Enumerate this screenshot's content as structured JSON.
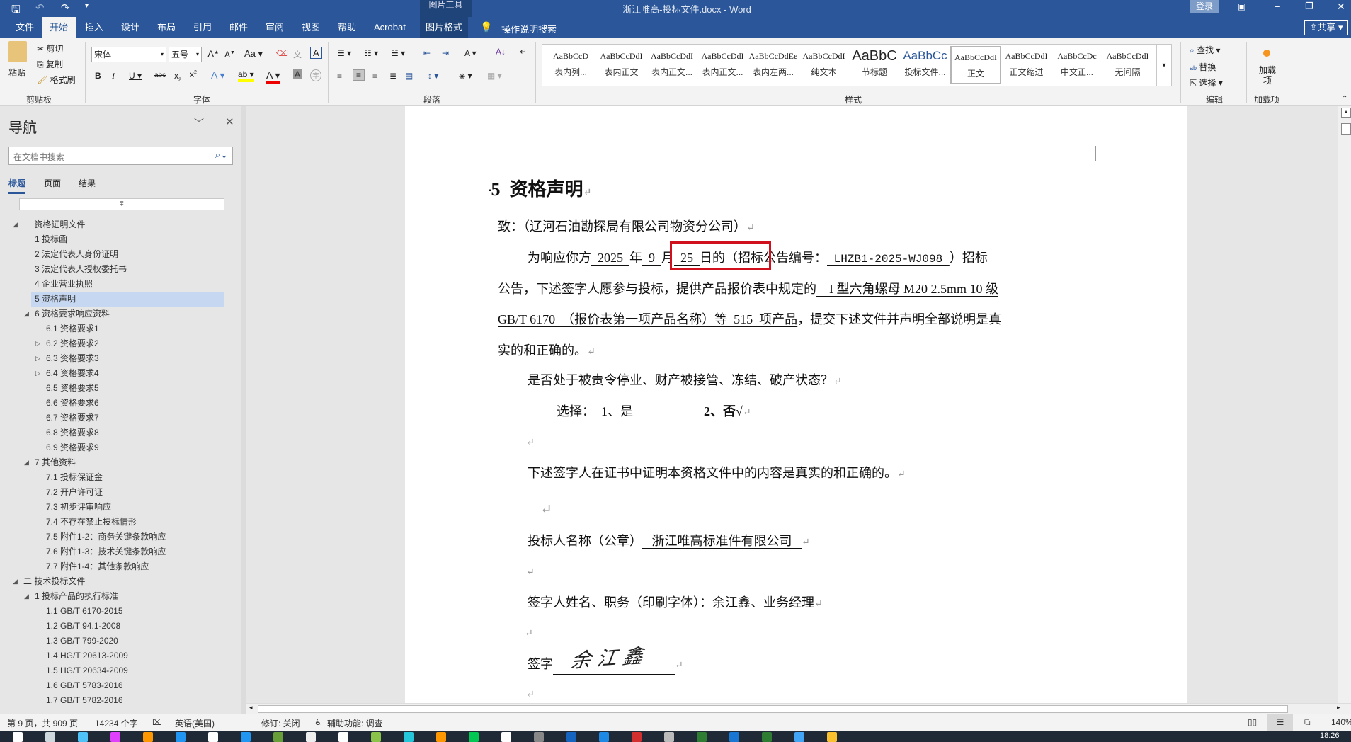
{
  "titlebar": {
    "context_tool": "图片工具",
    "title": "浙江唯高-投标文件.docx  -  Word",
    "login": "登录"
  },
  "tabs": [
    "文件",
    "开始",
    "插入",
    "设计",
    "布局",
    "引用",
    "邮件",
    "审阅",
    "视图",
    "帮助",
    "Acrobat",
    "图片格式"
  ],
  "active_tab": "开始",
  "tell_me": "操作说明搜索",
  "share": "共享",
  "ribbon": {
    "clipboard": {
      "paste": "粘贴",
      "cut": "剪切",
      "copy": "复制",
      "format_painter": "格式刷",
      "label": "剪贴板"
    },
    "font": {
      "name": "宋体",
      "size": "五号",
      "label": "字体",
      "change_case": "Aa"
    },
    "paragraph": {
      "label": "段落"
    },
    "styles": {
      "label": "样式",
      "items": [
        {
          "preview": "AaBbCcD",
          "name": "表内列..."
        },
        {
          "preview": "AaBbCcDdI",
          "name": "表内正文"
        },
        {
          "preview": "AaBbCcDdI",
          "name": "表内正文..."
        },
        {
          "preview": "AaBbCcDdI",
          "name": "表内正文..."
        },
        {
          "preview": "AaBbCcDdEe",
          "name": "表内左两..."
        },
        {
          "preview": "AaBbCcDdI",
          "name": "纯文本"
        },
        {
          "preview": "AaBbC",
          "name": "节标题"
        },
        {
          "preview": "AaBbCc",
          "name": "投标文件..."
        },
        {
          "preview": "AaBbCcDdI",
          "name": "正文"
        },
        {
          "preview": "AaBbCcDdI",
          "name": "正文缩进"
        },
        {
          "preview": "AaBbCcDc",
          "name": "中文正..."
        },
        {
          "preview": "AaBbCcDdI",
          "name": "无间隔"
        }
      ]
    },
    "editing": {
      "find": "查找",
      "replace": "替换",
      "select": "选择",
      "label": "编辑"
    },
    "addins": {
      "button": "加载项",
      "label": "加载项"
    }
  },
  "nav": {
    "title": "导航",
    "search_placeholder": "在文档中搜索",
    "tabs": [
      "标题",
      "页面",
      "结果"
    ],
    "items": [
      {
        "text": "一 资格证明文件",
        "level": 1,
        "state": "open"
      },
      {
        "text": "1 投标函",
        "level": 2,
        "state": ""
      },
      {
        "text": "2 法定代表人身份证明",
        "level": 2,
        "state": ""
      },
      {
        "text": "3 法定代表人授权委托书",
        "level": 2,
        "state": ""
      },
      {
        "text": "4 企业营业执照",
        "level": 2,
        "state": ""
      },
      {
        "text": "5 资格声明",
        "level": 2,
        "state": "",
        "selected": true
      },
      {
        "text": "6 资格要求响应资料",
        "level": 2,
        "state": "open"
      },
      {
        "text": "6.1 资格要求1",
        "level": 3,
        "state": ""
      },
      {
        "text": "6.2 资格要求2",
        "level": 3,
        "state": "closed"
      },
      {
        "text": "6.3 资格要求3",
        "level": 3,
        "state": "closed"
      },
      {
        "text": "6.4 资格要求4",
        "level": 3,
        "state": "closed"
      },
      {
        "text": "6.5 资格要求5",
        "level": 3,
        "state": ""
      },
      {
        "text": "6.6 资格要求6",
        "level": 3,
        "state": ""
      },
      {
        "text": "6.7 资格要求7",
        "level": 3,
        "state": ""
      },
      {
        "text": "6.8 资格要求8",
        "level": 3,
        "state": ""
      },
      {
        "text": "6.9 资格要求9",
        "level": 3,
        "state": ""
      },
      {
        "text": "7 其他资料",
        "level": 2,
        "state": "open"
      },
      {
        "text": "7.1 投标保证金",
        "level": 3,
        "state": ""
      },
      {
        "text": "7.2 开户许可证",
        "level": 3,
        "state": ""
      },
      {
        "text": "7.3 初步评审响应",
        "level": 3,
        "state": ""
      },
      {
        "text": "7.4 不存在禁止投标情形",
        "level": 3,
        "state": ""
      },
      {
        "text": "7.5 附件1-2：商务关键条款响应",
        "level": 3,
        "state": ""
      },
      {
        "text": "7.6 附件1-3：技术关键条款响应",
        "level": 3,
        "state": ""
      },
      {
        "text": "7.7 附件1-4：其他条款响应",
        "level": 3,
        "state": ""
      },
      {
        "text": "二 技术投标文件",
        "level": 1,
        "state": "open"
      },
      {
        "text": "1 投标产品的执行标准",
        "level": 2,
        "state": "open"
      },
      {
        "text": "1.1 GB/T 6170-2015",
        "level": 3,
        "state": ""
      },
      {
        "text": "1.2 GB/T 94.1-2008",
        "level": 3,
        "state": ""
      },
      {
        "text": "1.3 GB/T 799-2020",
        "level": 3,
        "state": ""
      },
      {
        "text": "1.4 HG/T 20613-2009",
        "level": 3,
        "state": ""
      },
      {
        "text": "1.5 HG/T 20634-2009",
        "level": 3,
        "state": ""
      },
      {
        "text": "1.6 GB/T 5783-2016",
        "level": 3,
        "state": ""
      },
      {
        "text": "1.7 GB/T 5782-2016",
        "level": 3,
        "state": ""
      }
    ]
  },
  "doc": {
    "heading_num": "5",
    "heading": "资格声明",
    "to": "致：（辽河石油勘探局有限公司物资分公司）",
    "p1_a": "为响应你方",
    "year": "  2025  ",
    "nian": "年",
    "month": "  9  ",
    "yue": "月",
    "day": "  25  ",
    "p1_b": "日的（招标公告编号：",
    "notice_no": " LHZB1-2025-WJ098 ",
    "p1_c": "）招标",
    "p2_a": "公告，下述签字人愿参与投标，提供产品报价表中规定的",
    "product": "    I 型六角螺母 M20 2.5mm 10 级",
    "product2": "GB/T 6170  （报价表第一项产品名称）等  515  项产品",
    "p3_b": "，提交下述文件并声明全部说明是真",
    "p4": "实的和正确的。",
    "q": "是否处于被责令停业、财产被接管、冻结、破产状态？",
    "choice_label": "选择：  1、是",
    "choice_no": "2、否√",
    "certify": "下述签字人在证书中证明本资格文件中的内容是真实的和正确的。",
    "bidder_label": "投标人名称（公章）",
    "bidder": "   浙江唯高标准件有限公司   ",
    "signer": "签字人姓名、职务（印刷字体）：余江鑫、业务经理",
    "sign_label": "签字",
    "signature": "余江鑫"
  },
  "status": {
    "page": "第 9 页，共 909 页",
    "words": "14234 个字",
    "lang": "英语(美国)",
    "track": "修订: 关闭",
    "accessibility": "辅助功能: 调查",
    "zoom": "140%"
  },
  "taskbar": {
    "time": "18:26"
  },
  "colors": {
    "accent": "#2b579a",
    "highlight": "#c5d7f1",
    "annotation_box": "#d0101c"
  }
}
